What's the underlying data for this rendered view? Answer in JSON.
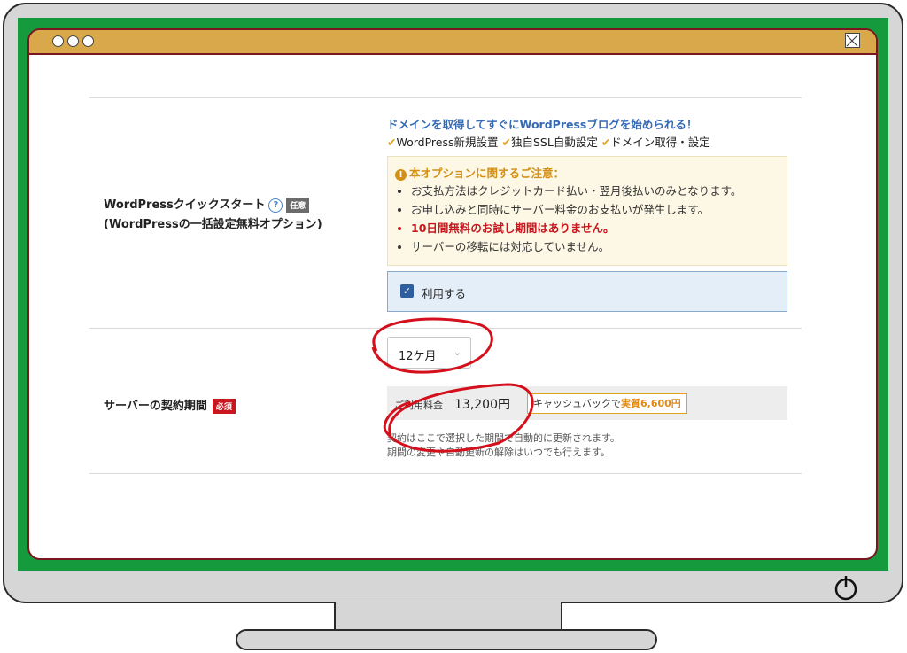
{
  "wp_quickstart": {
    "label_line1": "WordPressクイックスタート",
    "help_icon": "?",
    "optional_tag": "任意",
    "label_line2": "(WordPressの一括設定無料オプション)",
    "headline": "ドメインを取得してすぐにWordPressブログを始められる！",
    "features": [
      "WordPress新規設置",
      "独自SSL自動設定",
      "ドメイン取得・設定"
    ],
    "notice_title": "本オプションに関するご注意：",
    "notice_items": [
      "お支払方法はクレジットカード払い・翌月後払いのみとなります。",
      "お申し込みと同時にサーバー料金のお支払いが発生します。",
      "10日間無料のお試し期間はありません。",
      "サーバーの移転には対応していません。"
    ],
    "use_checkbox_label": "利用する"
  },
  "contract": {
    "label": "サーバーの契約期間",
    "required_tag": "必須",
    "period_selected": "12ケ月",
    "price_label": "ご利用料金",
    "price_value": "13,200円",
    "cashback_prefix": "キャッシュバックで",
    "cashback_value": "実質6,600円",
    "note_line1": "契約はここで選択した期間で自動的に更新されます。",
    "note_line2": "期間の変更や自動更新の解除はいつでも行えます。"
  },
  "colors": {
    "bezel_green": "#169a3e",
    "titlebar": "#d8a84a",
    "accent_blue": "#356ab5",
    "warning_orange": "#d39016",
    "required_red": "#c8171e",
    "annotation_red": "#d3101c"
  },
  "icons": [
    "help-icon",
    "warning-icon",
    "check-icon",
    "close-icon",
    "power-icon",
    "chevron-down-icon"
  ]
}
